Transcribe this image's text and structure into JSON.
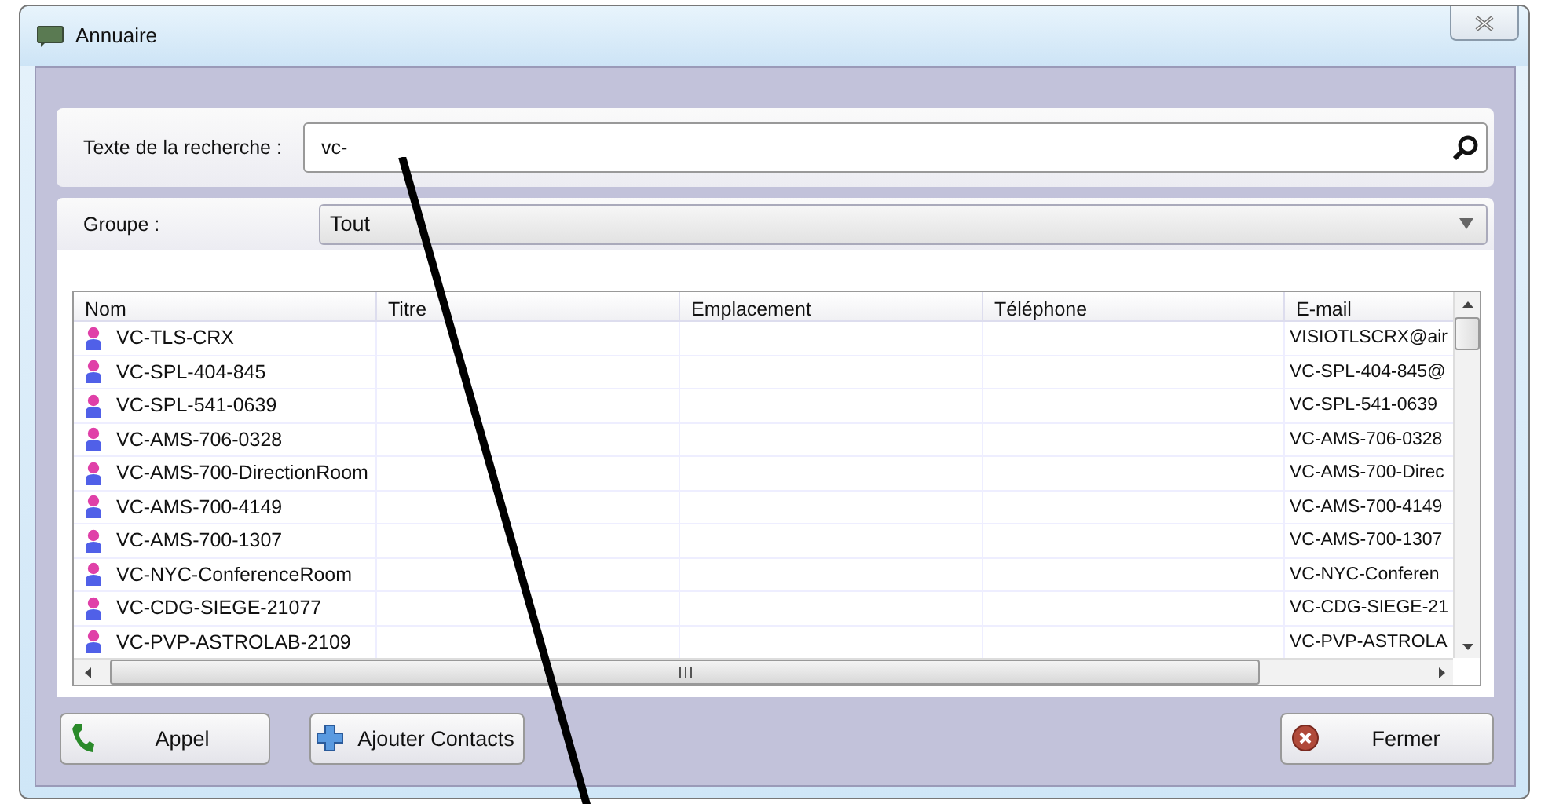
{
  "window": {
    "title": "Annuaire"
  },
  "search": {
    "label": "Texte de la recherche :",
    "value": "vc-"
  },
  "group": {
    "label": "Groupe :",
    "value": "Tout"
  },
  "table": {
    "columns": [
      "Nom",
      "Titre",
      "Emplacement",
      "Téléphone",
      "E-mail"
    ],
    "rows": [
      {
        "name": "VC-TLS-CRX",
        "email": "VISIOTLSCRX@air"
      },
      {
        "name": "VC-SPL-404-845",
        "email": "VC-SPL-404-845@"
      },
      {
        "name": "VC-SPL-541-0639",
        "email": "VC-SPL-541-0639"
      },
      {
        "name": "VC-AMS-706-0328",
        "email": "VC-AMS-706-0328"
      },
      {
        "name": "VC-AMS-700-DirectionRoom",
        "email": "VC-AMS-700-Direc"
      },
      {
        "name": "VC-AMS-700-4149",
        "email": "VC-AMS-700-4149"
      },
      {
        "name": "VC-AMS-700-1307",
        "email": "VC-AMS-700-1307"
      },
      {
        "name": "VC-NYC-ConferenceRoom",
        "email": "VC-NYC-Conferen"
      },
      {
        "name": "VC-CDG-SIEGE-21077",
        "email": "VC-CDG-SIEGE-21"
      },
      {
        "name": "VC-PVP-ASTROLAB-2109",
        "email": "VC-PVP-ASTROLA"
      }
    ]
  },
  "buttons": [
    {
      "kind": "call",
      "label": "Appel"
    },
    {
      "kind": "add",
      "label": "Ajouter Contacts"
    },
    {
      "kind": "close",
      "label": "Fermer"
    }
  ]
}
